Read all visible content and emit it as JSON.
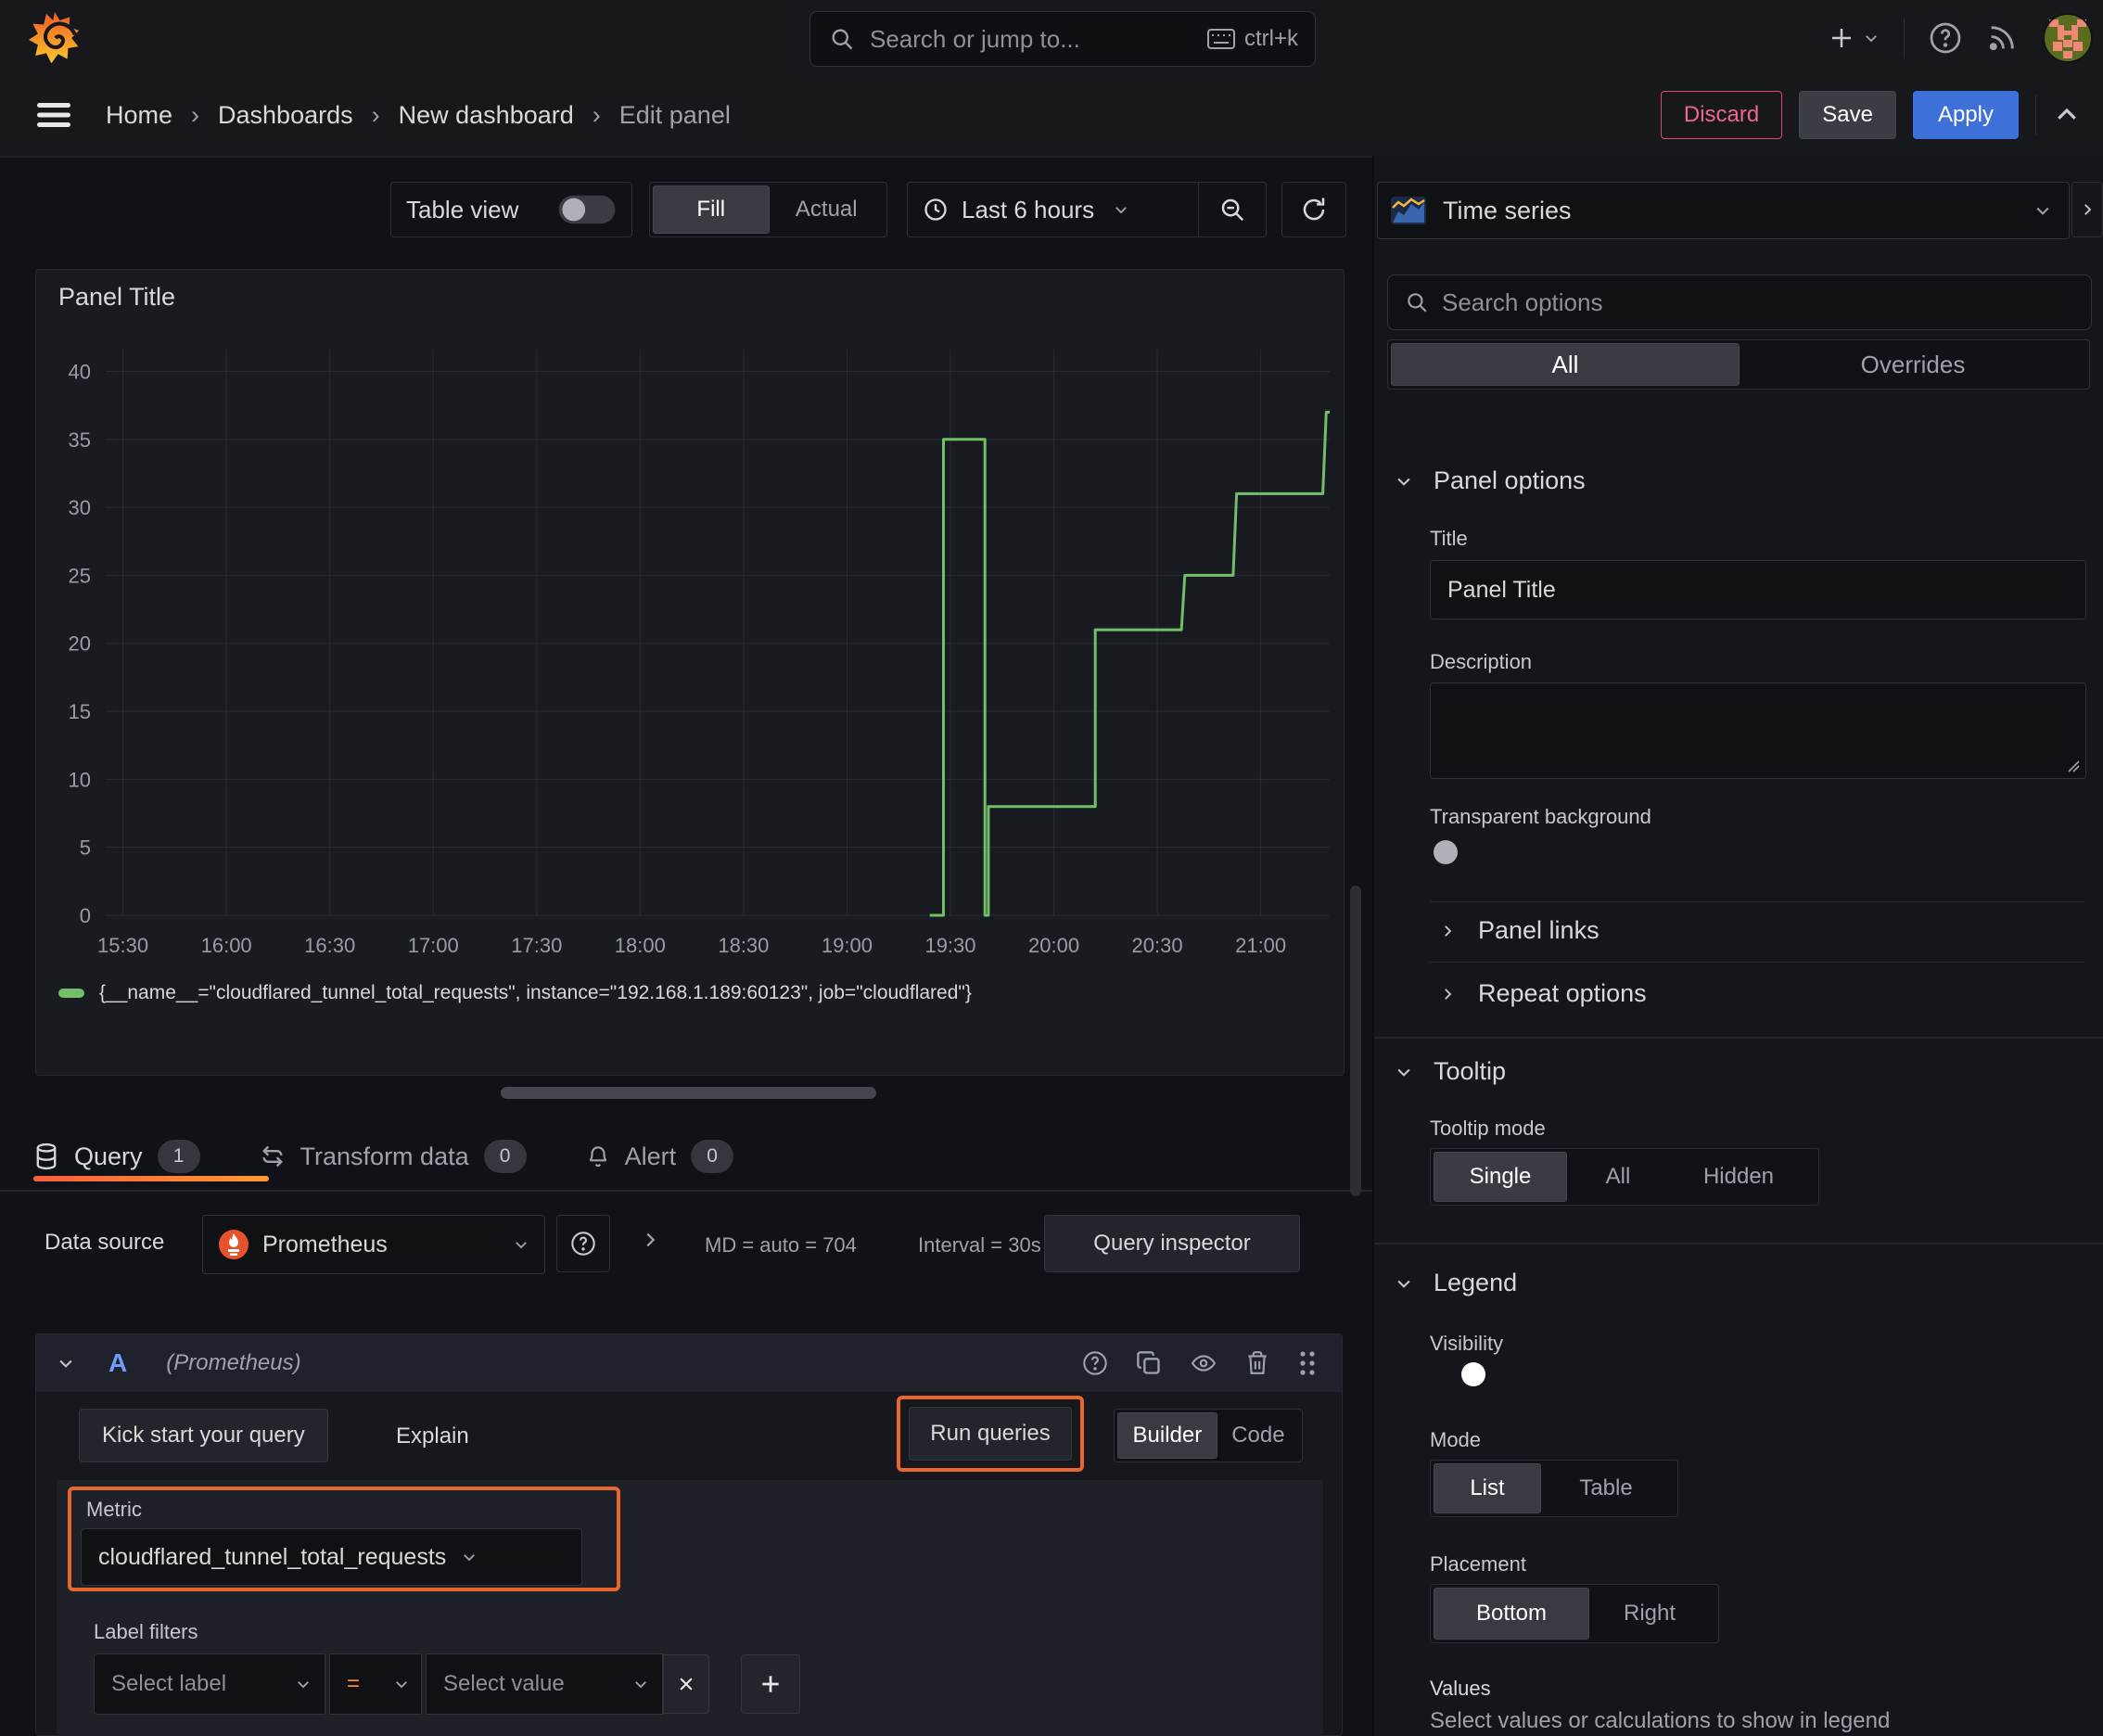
{
  "topnav": {
    "search_placeholder": "Search or jump to...",
    "shortcut": "ctrl+k"
  },
  "breadcrumb": {
    "items": [
      "Home",
      "Dashboards",
      "New dashboard",
      "Edit panel"
    ]
  },
  "header_actions": {
    "discard": "Discard",
    "save": "Save",
    "apply": "Apply"
  },
  "toolbar": {
    "table_view": "Table view",
    "fill": "Fill",
    "actual": "Actual",
    "time_range": "Last 6 hours"
  },
  "viz_picker": {
    "label": "Time series"
  },
  "panel": {
    "title": "Panel Title"
  },
  "chart_data": {
    "type": "line",
    "title": "Panel Title",
    "xlabel": "",
    "ylabel": "",
    "x_ticks": [
      "15:30",
      "16:00",
      "16:30",
      "17:00",
      "17:30",
      "18:00",
      "18:30",
      "19:00",
      "19:30",
      "20:00",
      "20:30",
      "21:00"
    ],
    "y_ticks": [
      0,
      5,
      10,
      15,
      20,
      25,
      30,
      35,
      40
    ],
    "xlim": [
      "15:25",
      "21:20"
    ],
    "ylim": [
      0,
      41.6
    ],
    "grid": true,
    "legend_position": "bottom",
    "series": [
      {
        "name": "{__name__=\"cloudflared_tunnel_total_requests\", instance=\"192.168.1.189:60123\", job=\"cloudflared\"}",
        "color": "#73bf69",
        "points": [
          [
            "19:24",
            0
          ],
          [
            "19:28",
            0
          ],
          [
            "19:28",
            35
          ],
          [
            "19:39",
            35
          ],
          [
            "19:40",
            35
          ],
          [
            "19:40",
            0
          ],
          [
            "19:41",
            0
          ],
          [
            "19:41",
            8
          ],
          [
            "20:12",
            8
          ],
          [
            "20:12",
            21
          ],
          [
            "20:37",
            21
          ],
          [
            "20:38",
            25
          ],
          [
            "20:52",
            25
          ],
          [
            "20:53",
            31
          ],
          [
            "21:18",
            31
          ],
          [
            "21:19",
            37
          ],
          [
            "21:20",
            37
          ]
        ]
      }
    ]
  },
  "options_pane": {
    "search_placeholder": "Search options",
    "tab_all": "All",
    "tab_overrides": "Overrides",
    "panel_options": {
      "heading": "Panel options",
      "title_label": "Title",
      "title_value": "Panel Title",
      "description_label": "Description",
      "transparent_label": "Transparent background"
    },
    "panel_links": "Panel links",
    "repeat_options": "Repeat options",
    "tooltip": {
      "heading": "Tooltip",
      "mode_label": "Tooltip mode",
      "options": [
        "Single",
        "All",
        "Hidden"
      ],
      "selected": "Single"
    },
    "legend": {
      "heading": "Legend",
      "visibility_label": "Visibility",
      "mode_label": "Mode",
      "mode_options": [
        "List",
        "Table"
      ],
      "mode_selected": "List",
      "placement_label": "Placement",
      "placement_options": [
        "Bottom",
        "Right"
      ],
      "placement_selected": "Bottom",
      "values_label": "Values",
      "values_hint": "Select values or calculations to show in legend"
    }
  },
  "query_section": {
    "tabs": [
      {
        "label": "Query",
        "count": "1"
      },
      {
        "label": "Transform data",
        "count": "0"
      },
      {
        "label": "Alert",
        "count": "0"
      }
    ],
    "datasource": {
      "label": "Data source",
      "name": "Prometheus",
      "max_dp": "MD = auto = 704",
      "interval": "Interval = 30s",
      "inspector": "Query inspector"
    },
    "row": {
      "ref": "A",
      "ds_hint": "(Prometheus)"
    },
    "builder": {
      "kick_start": "Kick start your query",
      "explain": "Explain",
      "run": "Run queries",
      "mode_builder": "Builder",
      "mode_code": "Code",
      "metric_label": "Metric",
      "metric_value": "cloudflared_tunnel_total_requests",
      "label_filters": "Label filters",
      "select_label": "Select label",
      "op": "=",
      "select_value": "Select value"
    }
  },
  "colors": {
    "accent_orange": "#e8672c",
    "series_green": "#73bf69",
    "accent_blue": "#3d71d9",
    "discard_pink": "#e8417c"
  }
}
